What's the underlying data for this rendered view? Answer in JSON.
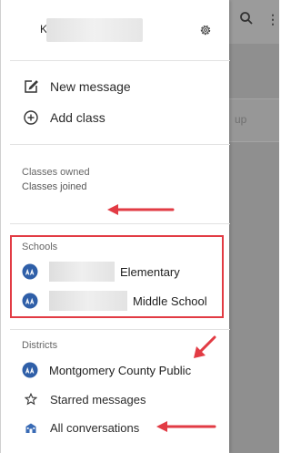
{
  "header": {
    "user_initial": "K"
  },
  "actions": {
    "new_message": "New message",
    "add_class": "Add class"
  },
  "classes": {
    "owned_label": "Classes owned",
    "joined_label": "Classes joined"
  },
  "schools": {
    "section_label": "Schools",
    "items": [
      {
        "label": "Elementary"
      },
      {
        "label": "Middle School"
      }
    ]
  },
  "districts": {
    "section_label": "Districts",
    "items": [
      {
        "label": "Montgomery County Public"
      }
    ]
  },
  "bottom": {
    "starred": "Starred messages",
    "all_conversations": "All conversations"
  },
  "backdrop": {
    "partial_text": "up"
  },
  "colors": {
    "annotation_red": "#e23b44",
    "school_icon_blue": "#2f5fa8"
  }
}
